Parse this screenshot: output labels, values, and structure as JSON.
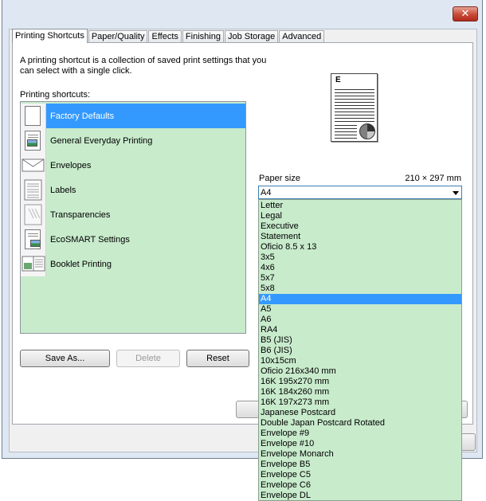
{
  "window": {
    "close_label": "✕"
  },
  "tabs": [
    {
      "label": "Printing Shortcuts",
      "active": true
    },
    {
      "label": "Paper/Quality"
    },
    {
      "label": "Effects"
    },
    {
      "label": "Finishing"
    },
    {
      "label": "Job Storage"
    },
    {
      "label": "Advanced"
    }
  ],
  "intro_text": "A printing shortcut is a collection of saved print settings that you can select with a single click.",
  "shortcuts_label": "Printing shortcuts:",
  "shortcuts": [
    {
      "label": "Factory Defaults",
      "icon": "blank-page-icon",
      "selected": true
    },
    {
      "label": "General Everyday Printing",
      "icon": "photo-page-icon"
    },
    {
      "label": "Envelopes",
      "icon": "envelope-icon"
    },
    {
      "label": "Labels",
      "icon": "labels-icon"
    },
    {
      "label": "Transparencies",
      "icon": "transparency-icon"
    },
    {
      "label": "EcoSMART Settings",
      "icon": "ecosmart-icon"
    },
    {
      "label": "Booklet Printing",
      "icon": "booklet-icon"
    }
  ],
  "buttons": {
    "save_as": "Save As...",
    "delete": "Delete",
    "reset": "Reset"
  },
  "preview": {
    "letter": "E"
  },
  "paper_size": {
    "label": "Paper size",
    "dimensions": "210 × 297 mm",
    "selected": "A4",
    "options": [
      "Letter",
      "Legal",
      "Executive",
      "Statement",
      "Oficio 8.5 x 13",
      "3x5",
      "4x6",
      "5x7",
      "5x8",
      "A4",
      "A5",
      "A6",
      "RA4",
      "B5 (JIS)",
      "B6 (JIS)",
      "10x15cm",
      "Oficio 216x340 mm",
      "16K 195x270 mm",
      "16K 184x260 mm",
      "16K 197x273 mm",
      "Japanese Postcard",
      "Double Japan Postcard Rotated",
      "Envelope #9",
      "Envelope #10",
      "Envelope Monarch",
      "Envelope B5",
      "Envelope C5",
      "Envelope C6",
      "Envelope DL"
    ]
  },
  "colors": {
    "selection": "#3399ff",
    "list_bg": "#c8ebcc",
    "window_frame": "#dfe8f2"
  }
}
